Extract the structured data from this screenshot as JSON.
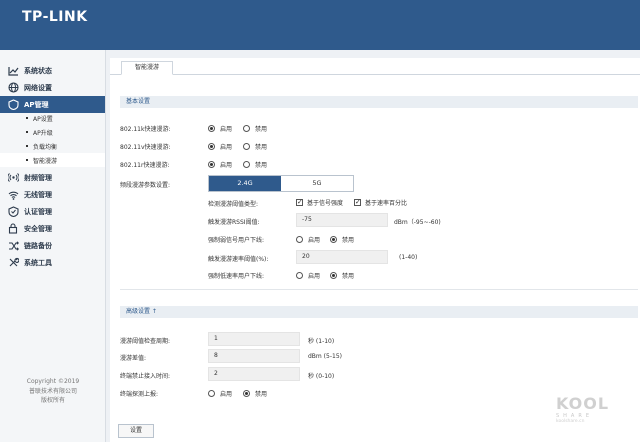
{
  "brand": {
    "logo": "TP-LINK"
  },
  "sidebar": {
    "items": [
      {
        "label": "系统状态",
        "icon": "chart-line-icon"
      },
      {
        "label": "网络设置",
        "icon": "globe-icon"
      },
      {
        "label": "AP管理",
        "icon": "shield-icon"
      },
      {
        "label": "射频管理",
        "icon": "wifi-signal-icon"
      },
      {
        "label": "无线管理",
        "icon": "wifi-icon"
      },
      {
        "label": "认证管理",
        "icon": "shield-check-icon"
      },
      {
        "label": "安全管理",
        "icon": "lock-icon"
      },
      {
        "label": "链路备份",
        "icon": "shuffle-icon"
      },
      {
        "label": "系统工具",
        "icon": "tools-icon"
      }
    ],
    "sub_items": [
      "AP设置",
      "AP升级",
      "负载均衡",
      "智能漫游"
    ],
    "copyright": [
      "Copyright ©2019",
      "普联技术有限公司",
      "版权所有"
    ]
  },
  "tab": {
    "label": "智能漫游"
  },
  "basic": {
    "title": "基本设置",
    "rows": [
      {
        "label": "802.11k快速漫游:",
        "on": "启用",
        "off": "禁用",
        "value": "on"
      },
      {
        "label": "802.11v快速漫游:",
        "on": "启用",
        "off": "禁用",
        "value": "on"
      },
      {
        "label": "802.11r快速漫游:",
        "on": "启用",
        "off": "禁用",
        "value": "on"
      }
    ],
    "band_label": "频段漫游参数设置:",
    "bands": [
      "2.4G",
      "5G"
    ],
    "band_selected": "2.4G",
    "detect_label": "检测漫游阈值类型:",
    "detect_opts": [
      "基于信号强度",
      "基于速率百分比"
    ],
    "rssi_label": "触发漫游RSSI阈值:",
    "rssi_value": "-75",
    "rssi_unit": "dBm（-95~-60)",
    "weak_label": "强制弱信号用户下线:",
    "weak_on": "启用",
    "weak_off": "禁用",
    "rate_label": "触发漫游速率阈值(%):",
    "rate_value": "20",
    "rate_unit": "(1-40)",
    "lowrate_label": "强制低速率用户下线:",
    "lowrate_on": "启用",
    "lowrate_off": "禁用"
  },
  "advanced": {
    "title": "高级设置 ↑",
    "period_label": "漫游阈值检查周期:",
    "period_value": "1",
    "period_unit": "秒 (1-10)",
    "diff_label": "漫游差值:",
    "diff_value": "8",
    "diff_unit": "dBm (5-15)",
    "ban_label": "终端禁止接入时间:",
    "ban_value": "2",
    "ban_unit": "秒 (0-10)",
    "report_label": "终端探测上报:",
    "report_on": "启用",
    "report_off": "禁用"
  },
  "save_label": "设置",
  "watermark": {
    "text": "KOOL",
    "sub": "SHARE",
    "site": "koolshare.cn"
  }
}
